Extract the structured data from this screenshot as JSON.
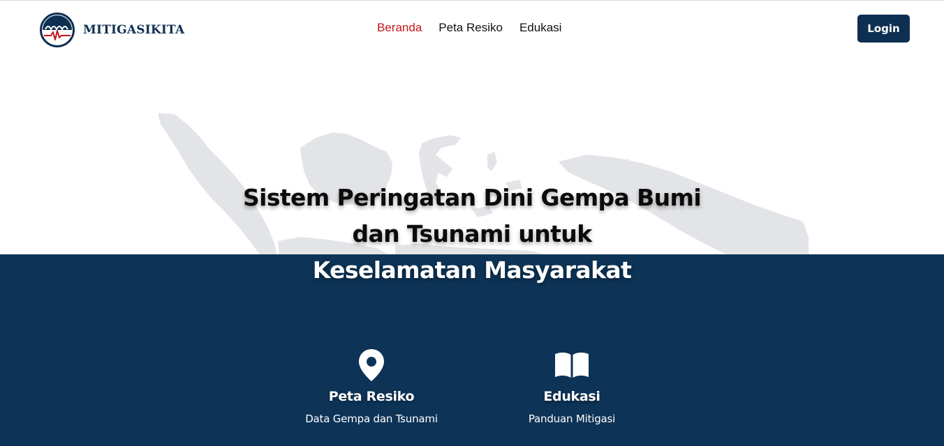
{
  "brand": {
    "name": "MITIGASIKITA",
    "logo_icon": "wave-seismograph-logo-icon"
  },
  "nav": {
    "items": [
      {
        "label": "Beranda",
        "active": true
      },
      {
        "label": "Peta Resiko",
        "active": false
      },
      {
        "label": "Edukasi",
        "active": false
      }
    ],
    "login_label": "Login"
  },
  "hero": {
    "line1": "Sistem Peringatan Dini Gempa Bumi",
    "line2": "dan Tsunami untuk",
    "line3": "Keselamatan Masyarakat"
  },
  "features": [
    {
      "icon": "map-pin-icon",
      "title": "Peta Resiko",
      "description": "Data Gempa dan Tsunami"
    },
    {
      "icon": "open-book-icon",
      "title": "Edukasi",
      "description": "Panduan Mitigasi"
    }
  ],
  "colors": {
    "primary": "#0d2f52",
    "dark_section": "#0d3356",
    "active_nav": "#c4161c",
    "map_gray": "#e3e4e7"
  }
}
